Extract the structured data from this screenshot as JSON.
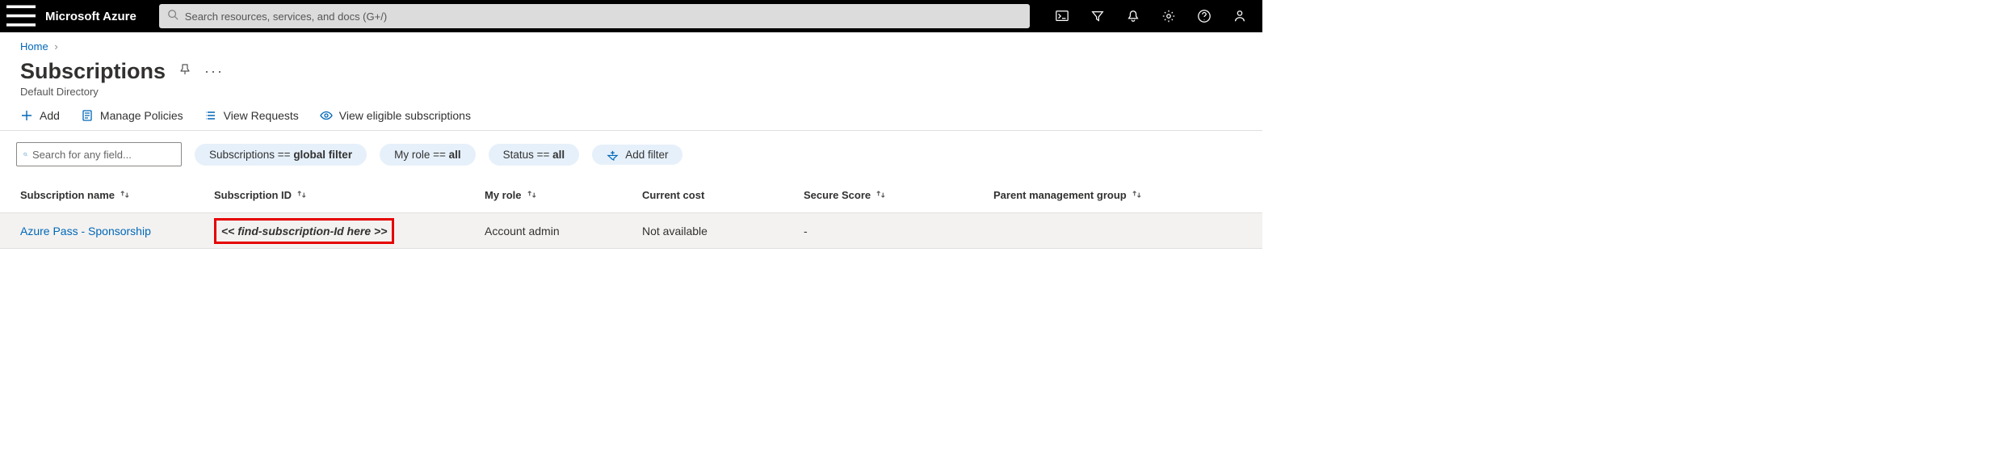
{
  "brand": "Microsoft Azure",
  "search": {
    "placeholder": "Search resources, services, and docs (G+/)"
  },
  "breadcrumb": {
    "home": "Home"
  },
  "page": {
    "title": "Subscriptions",
    "subtitle": "Default Directory"
  },
  "toolbar": {
    "add": "Add",
    "manage_policies": "Manage Policies",
    "view_requests": "View Requests",
    "view_eligible": "View eligible subscriptions"
  },
  "filters": {
    "search_placeholder": "Search for any field...",
    "pills": {
      "subscriptions_key": "Subscriptions == ",
      "subscriptions_val": "global filter",
      "role_key": "My role == ",
      "role_val": "all",
      "status_key": "Status == ",
      "status_val": "all"
    },
    "add_filter": "Add filter"
  },
  "table": {
    "headers": {
      "name": "Subscription name",
      "id": "Subscription ID",
      "role": "My role",
      "cost": "Current cost",
      "score": "Secure Score",
      "parent": "Parent management group"
    },
    "rows": [
      {
        "name": "Azure Pass - Sponsorship",
        "id": "<< find-subscription-Id here >>",
        "role": "Account admin",
        "cost": "Not available",
        "score": "-",
        "parent": ""
      }
    ]
  }
}
